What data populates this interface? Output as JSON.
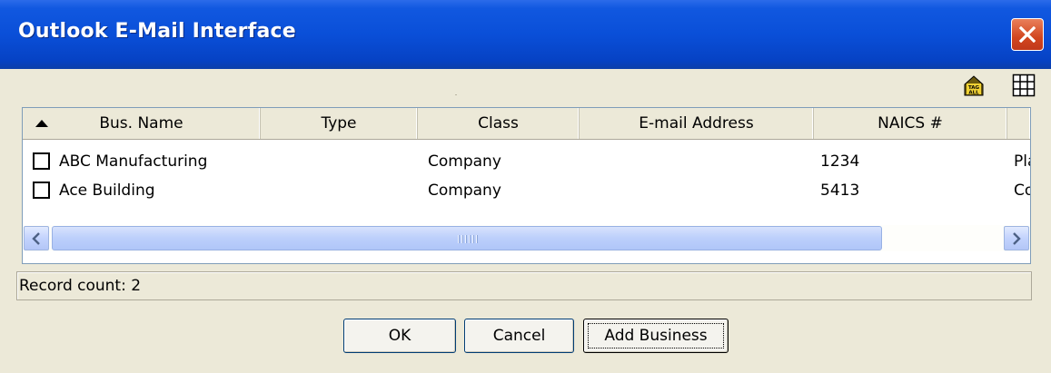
{
  "window": {
    "title": "Outlook E-Mail Interface"
  },
  "toolbar": {
    "icons": [
      "tag-all-icon",
      "grid-view-icon"
    ],
    "tag_icon_text": "TAG ALL"
  },
  "table": {
    "sorted_column": "Bus. Name",
    "sort_direction": "ascending",
    "columns": [
      "Bus. Name",
      "Type",
      "Class",
      "E-mail Address",
      "NAICS #",
      ""
    ],
    "rows": [
      {
        "checked": false,
        "name": "ABC Manufacturing",
        "type": "",
        "class": "Company",
        "email": "",
        "naics": "1234",
        "extra": "Pla"
      },
      {
        "checked": false,
        "name": "Ace Building",
        "type": "",
        "class": "Company",
        "email": "",
        "naics": "5413",
        "extra": "Co"
      }
    ]
  },
  "status": {
    "text": "Record count: 2"
  },
  "buttons": {
    "ok": "OK",
    "cancel": "Cancel",
    "add_business": "Add Business"
  }
}
